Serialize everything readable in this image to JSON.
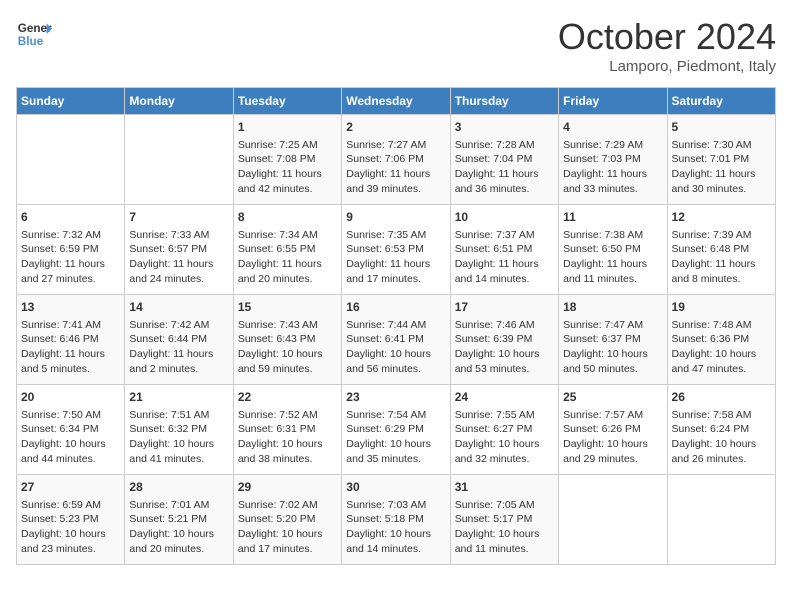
{
  "header": {
    "logo_line1": "General",
    "logo_line2": "Blue",
    "month": "October 2024",
    "location": "Lamporo, Piedmont, Italy"
  },
  "days_of_week": [
    "Sunday",
    "Monday",
    "Tuesday",
    "Wednesday",
    "Thursday",
    "Friday",
    "Saturday"
  ],
  "weeks": [
    [
      {
        "day": "",
        "info": ""
      },
      {
        "day": "",
        "info": ""
      },
      {
        "day": "1",
        "info": "Sunrise: 7:25 AM\nSunset: 7:08 PM\nDaylight: 11 hours and 42 minutes."
      },
      {
        "day": "2",
        "info": "Sunrise: 7:27 AM\nSunset: 7:06 PM\nDaylight: 11 hours and 39 minutes."
      },
      {
        "day": "3",
        "info": "Sunrise: 7:28 AM\nSunset: 7:04 PM\nDaylight: 11 hours and 36 minutes."
      },
      {
        "day": "4",
        "info": "Sunrise: 7:29 AM\nSunset: 7:03 PM\nDaylight: 11 hours and 33 minutes."
      },
      {
        "day": "5",
        "info": "Sunrise: 7:30 AM\nSunset: 7:01 PM\nDaylight: 11 hours and 30 minutes."
      }
    ],
    [
      {
        "day": "6",
        "info": "Sunrise: 7:32 AM\nSunset: 6:59 PM\nDaylight: 11 hours and 27 minutes."
      },
      {
        "day": "7",
        "info": "Sunrise: 7:33 AM\nSunset: 6:57 PM\nDaylight: 11 hours and 24 minutes."
      },
      {
        "day": "8",
        "info": "Sunrise: 7:34 AM\nSunset: 6:55 PM\nDaylight: 11 hours and 20 minutes."
      },
      {
        "day": "9",
        "info": "Sunrise: 7:35 AM\nSunset: 6:53 PM\nDaylight: 11 hours and 17 minutes."
      },
      {
        "day": "10",
        "info": "Sunrise: 7:37 AM\nSunset: 6:51 PM\nDaylight: 11 hours and 14 minutes."
      },
      {
        "day": "11",
        "info": "Sunrise: 7:38 AM\nSunset: 6:50 PM\nDaylight: 11 hours and 11 minutes."
      },
      {
        "day": "12",
        "info": "Sunrise: 7:39 AM\nSunset: 6:48 PM\nDaylight: 11 hours and 8 minutes."
      }
    ],
    [
      {
        "day": "13",
        "info": "Sunrise: 7:41 AM\nSunset: 6:46 PM\nDaylight: 11 hours and 5 minutes."
      },
      {
        "day": "14",
        "info": "Sunrise: 7:42 AM\nSunset: 6:44 PM\nDaylight: 11 hours and 2 minutes."
      },
      {
        "day": "15",
        "info": "Sunrise: 7:43 AM\nSunset: 6:43 PM\nDaylight: 10 hours and 59 minutes."
      },
      {
        "day": "16",
        "info": "Sunrise: 7:44 AM\nSunset: 6:41 PM\nDaylight: 10 hours and 56 minutes."
      },
      {
        "day": "17",
        "info": "Sunrise: 7:46 AM\nSunset: 6:39 PM\nDaylight: 10 hours and 53 minutes."
      },
      {
        "day": "18",
        "info": "Sunrise: 7:47 AM\nSunset: 6:37 PM\nDaylight: 10 hours and 50 minutes."
      },
      {
        "day": "19",
        "info": "Sunrise: 7:48 AM\nSunset: 6:36 PM\nDaylight: 10 hours and 47 minutes."
      }
    ],
    [
      {
        "day": "20",
        "info": "Sunrise: 7:50 AM\nSunset: 6:34 PM\nDaylight: 10 hours and 44 minutes."
      },
      {
        "day": "21",
        "info": "Sunrise: 7:51 AM\nSunset: 6:32 PM\nDaylight: 10 hours and 41 minutes."
      },
      {
        "day": "22",
        "info": "Sunrise: 7:52 AM\nSunset: 6:31 PM\nDaylight: 10 hours and 38 minutes."
      },
      {
        "day": "23",
        "info": "Sunrise: 7:54 AM\nSunset: 6:29 PM\nDaylight: 10 hours and 35 minutes."
      },
      {
        "day": "24",
        "info": "Sunrise: 7:55 AM\nSunset: 6:27 PM\nDaylight: 10 hours and 32 minutes."
      },
      {
        "day": "25",
        "info": "Sunrise: 7:57 AM\nSunset: 6:26 PM\nDaylight: 10 hours and 29 minutes."
      },
      {
        "day": "26",
        "info": "Sunrise: 7:58 AM\nSunset: 6:24 PM\nDaylight: 10 hours and 26 minutes."
      }
    ],
    [
      {
        "day": "27",
        "info": "Sunrise: 6:59 AM\nSunset: 5:23 PM\nDaylight: 10 hours and 23 minutes."
      },
      {
        "day": "28",
        "info": "Sunrise: 7:01 AM\nSunset: 5:21 PM\nDaylight: 10 hours and 20 minutes."
      },
      {
        "day": "29",
        "info": "Sunrise: 7:02 AM\nSunset: 5:20 PM\nDaylight: 10 hours and 17 minutes."
      },
      {
        "day": "30",
        "info": "Sunrise: 7:03 AM\nSunset: 5:18 PM\nDaylight: 10 hours and 14 minutes."
      },
      {
        "day": "31",
        "info": "Sunrise: 7:05 AM\nSunset: 5:17 PM\nDaylight: 10 hours and 11 minutes."
      },
      {
        "day": "",
        "info": ""
      },
      {
        "day": "",
        "info": ""
      }
    ]
  ]
}
